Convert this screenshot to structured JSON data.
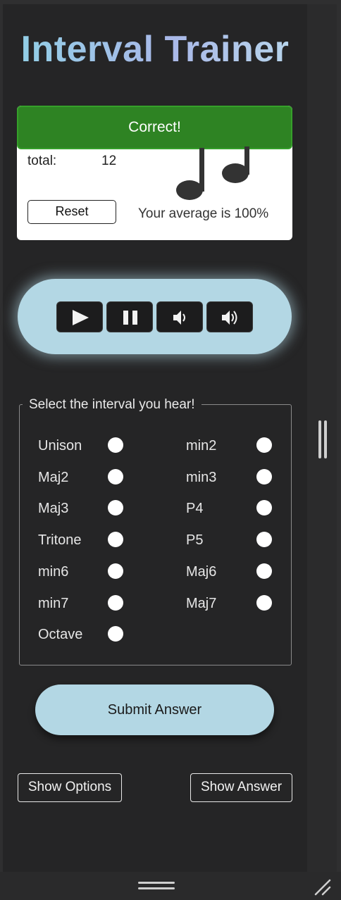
{
  "app": {
    "title": "Interval Trainer"
  },
  "score": {
    "status": "Correct!",
    "total_label": "total:",
    "total_value": "12",
    "reset_label": "Reset",
    "average_text": "Your average is 100%"
  },
  "player": {
    "buttons": [
      "play-icon",
      "pause-icon",
      "volume-down-icon",
      "volume-up-icon"
    ]
  },
  "intervals": {
    "legend": "Select the interval you hear!",
    "options": [
      "Unison",
      "min2",
      "Maj2",
      "min3",
      "Maj3",
      "P4",
      "Tritone",
      "P5",
      "min6",
      "Maj6",
      "min7",
      "Maj7",
      "Octave"
    ]
  },
  "actions": {
    "submit_label": "Submit Answer",
    "show_options_label": "Show Options",
    "show_answer_label": "Show Answer"
  },
  "colors": {
    "success_green": "#2e8323",
    "accent_blue": "#b3d7e4",
    "background": "#252526"
  }
}
